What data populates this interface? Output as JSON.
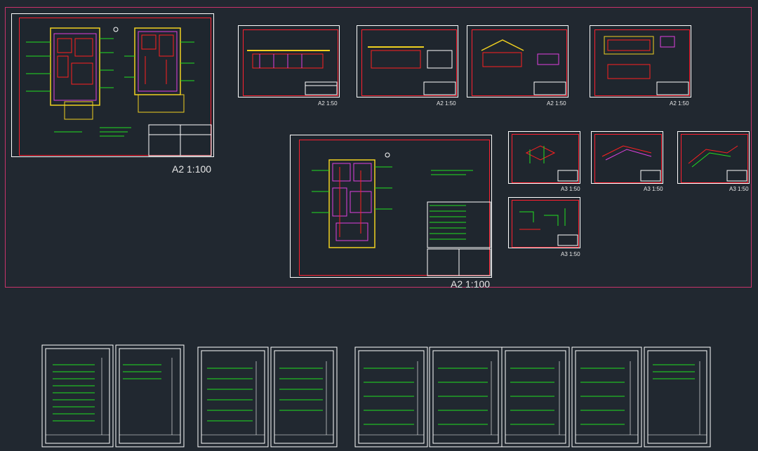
{
  "colors": {
    "background": "#212830",
    "outer_frame": "#c8336a",
    "sheet_border": "#ffffff",
    "drawing_border": "#ff2030",
    "annotation": "#20e020",
    "plan_lines": "#e040e0",
    "walls": "#f0d020",
    "pipes_red": "#ff2020"
  },
  "labels": {
    "sheet_a": "A2 1:100",
    "sheet_b": "A2 1:100",
    "sec1": "A2 1:50",
    "sec2": "A2 1:50",
    "sec3": "A2 1:50",
    "sec4": "A2 1:50",
    "iso1": "A3 1:50",
    "iso2": "A3 1:50",
    "iso3": "A3 1:50",
    "iso4": "A3 1:50"
  }
}
